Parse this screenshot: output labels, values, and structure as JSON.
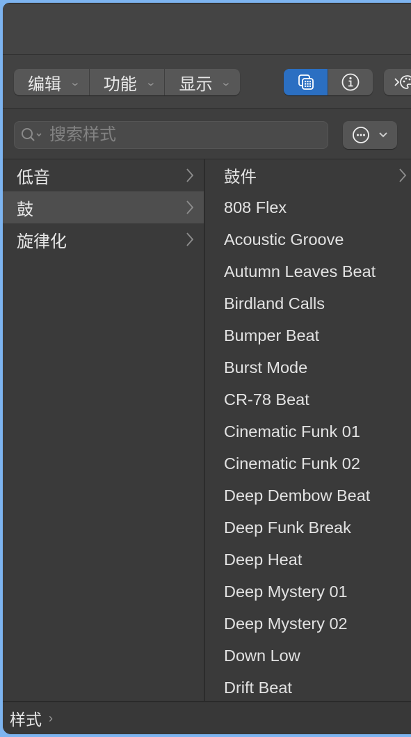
{
  "toolbar": {
    "menus": [
      {
        "label": "编辑",
        "icon": "chevron-down-icon"
      },
      {
        "label": "功能",
        "icon": "chevron-down-icon"
      },
      {
        "label": "显示",
        "icon": "chevron-down-icon"
      }
    ],
    "view_buttons": [
      {
        "icon": "browser-grid-icon",
        "active": true
      },
      {
        "icon": "info-icon",
        "active": false
      }
    ],
    "more_button": {
      "icon": "palette-chevron-icon"
    },
    "accent_color": "#2b6fc2"
  },
  "search": {
    "placeholder": "搜索样式",
    "value": "",
    "icon": "search-icon",
    "action_icon": "ellipsis-circle-icon"
  },
  "categories": [
    {
      "label": "低音",
      "selected": false
    },
    {
      "label": "鼓",
      "selected": true
    },
    {
      "label": "旋律化",
      "selected": false
    }
  ],
  "patterns": {
    "subfolder": {
      "label": "鼓件"
    },
    "items": [
      "808 Flex",
      "Acoustic Groove",
      "Autumn Leaves Beat",
      "Birdland Calls",
      "Bumper Beat",
      "Burst Mode",
      "CR-78 Beat",
      "Cinematic Funk 01",
      "Cinematic Funk 02",
      "Deep Dembow Beat",
      "Deep Funk Break",
      "Deep Heat",
      "Deep Mystery 01",
      "Deep Mystery 02",
      "Down Low",
      "Drift Beat"
    ]
  },
  "footer": {
    "label": "样式"
  }
}
